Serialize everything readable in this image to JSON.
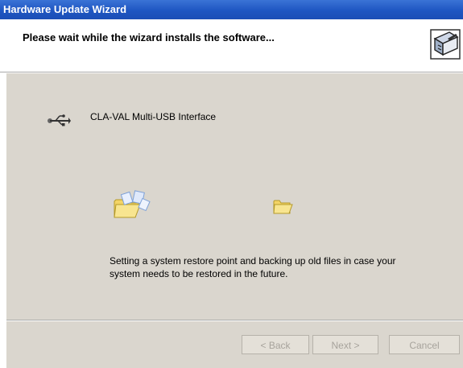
{
  "window": {
    "title": "Hardware Update Wizard"
  },
  "header": {
    "title": "Please wait while the wizard installs the software...",
    "icon": "hardware-wizard-icon"
  },
  "device": {
    "name": "CLA-VAL Multi-USB Interface",
    "icon": "usb-icon"
  },
  "animation": {
    "source_icon": "folder-with-flying-pages-icon",
    "dest_icon": "folder-icon"
  },
  "status": {
    "text": "Setting a system restore point and backing up old files in case your system needs to be restored in the future."
  },
  "buttons": {
    "back": "< Back",
    "next": "Next >",
    "cancel": "Cancel"
  },
  "colors": {
    "titlebar": "#1f56c2",
    "dialog_face": "#dad6ce",
    "disabled_text": "#a7a39c"
  }
}
